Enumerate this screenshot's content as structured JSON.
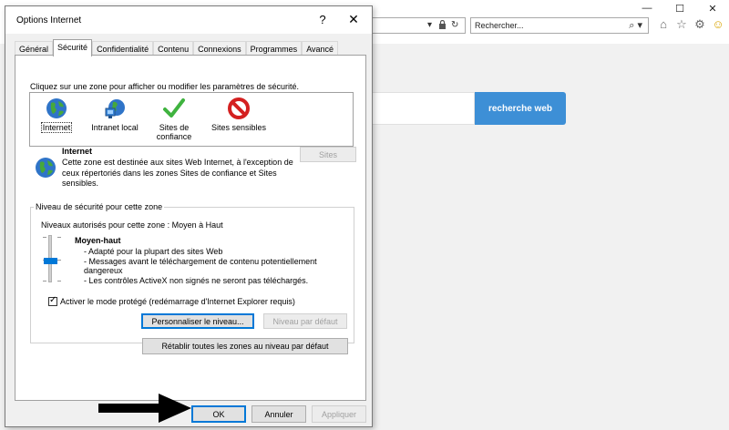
{
  "browser": {
    "search_placeholder": "Rechercher...",
    "web_search_button": "recherche web",
    "window_controls": [
      "—",
      "☐",
      "✕"
    ]
  },
  "dialog": {
    "title": "Options Internet",
    "help_glyph": "?",
    "close_glyph": "✕",
    "tabs": [
      {
        "label": "Général",
        "active": false
      },
      {
        "label": "Sécurité",
        "active": true
      },
      {
        "label": "Confidentialité",
        "active": false
      },
      {
        "label": "Contenu",
        "active": false
      },
      {
        "label": "Connexions",
        "active": false
      },
      {
        "label": "Programmes",
        "active": false
      },
      {
        "label": "Avancé",
        "active": false
      }
    ],
    "instruction": "Cliquez sur une zone pour afficher ou modifier les paramètres de sécurité.",
    "zones": [
      {
        "label": "Internet",
        "icon": "globe-icon",
        "selected": true
      },
      {
        "label": "Intranet local",
        "icon": "network-icon",
        "selected": false
      },
      {
        "label": "Sites de confiance",
        "icon": "checkmark-icon",
        "selected": false
      },
      {
        "label": "Sites sensibles",
        "icon": "blocked-icon",
        "selected": false
      }
    ],
    "zone_desc": {
      "title": "Internet",
      "text": "Cette zone est destinée aux sites Web Internet, à l'exception de ceux répertoriés dans les zones Sites de confiance et Sites sensibles."
    },
    "sites_button": "Sites",
    "level": {
      "legend": "Niveau de sécurité pour cette zone",
      "allowed": "Niveaux autorisés pour cette zone : Moyen à Haut",
      "name": "Moyen-haut",
      "details": [
        "- Adapté pour la plupart des sites Web",
        "- Messages avant le téléchargement de contenu potentiellement dangereux",
        "- Les contrôles ActiveX non signés ne seront pas téléchargés."
      ],
      "protected_mode": "Activer le mode protégé (redémarrage d'Internet Explorer requis)",
      "protected_checked": true,
      "custom_button": "Personnaliser le niveau...",
      "default_button": "Niveau par défaut"
    },
    "reset_all_button": "Rétablir toutes les zones au niveau par défaut",
    "ok_button": "OK",
    "cancel_button": "Annuler",
    "apply_button": "Appliquer"
  }
}
